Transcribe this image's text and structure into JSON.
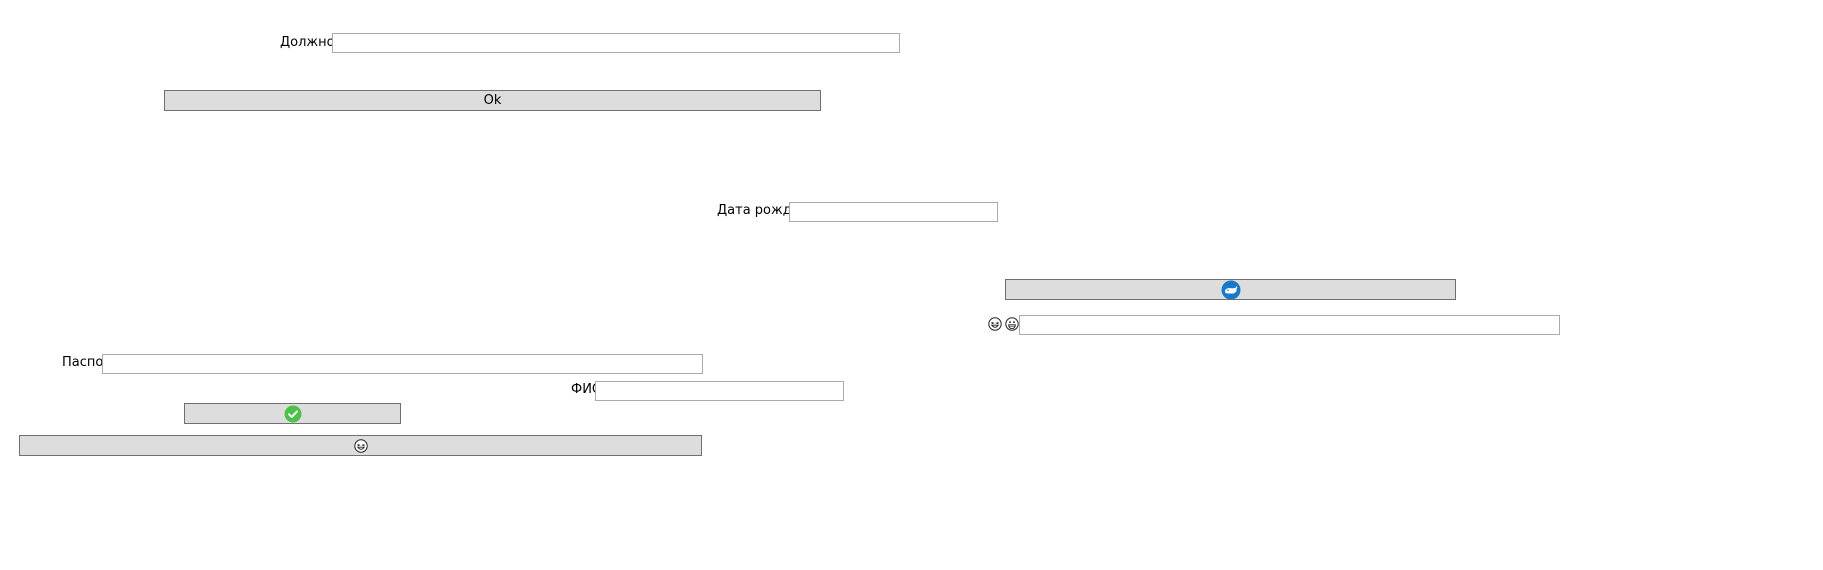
{
  "form": {
    "position_label": "Должность",
    "position_value": "",
    "ok_label": "Ok",
    "birth_date_label": "Дата рождения",
    "birth_date_value": "",
    "emoji_field_value": "",
    "passport_label": "Паспорт",
    "passport_value": "",
    "fio_label": "ФИО",
    "fio_value": ""
  },
  "icons": {
    "whale_button": "whale-icon",
    "emoji_label_1": "grinning-squint-emoji-icon",
    "emoji_label_2": "grinning-emoji-icon",
    "check_button": "green-check-icon",
    "bottom_button": "grinning-squint-emoji-icon"
  },
  "colors": {
    "button_bg": "#dddddd",
    "button_border": "#707070",
    "field_border": "#ababab",
    "check_green": "#4cc24a",
    "whale_blue": "#1a78c8"
  }
}
